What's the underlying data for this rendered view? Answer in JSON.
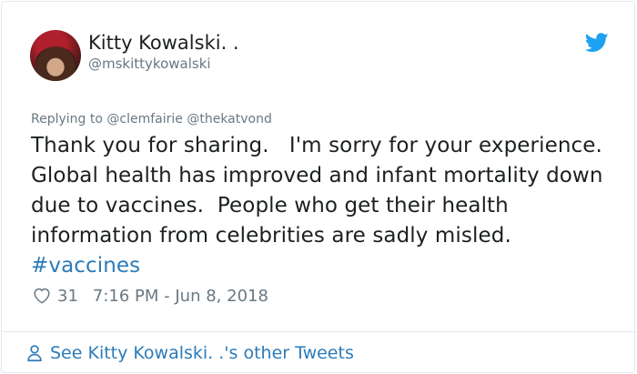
{
  "tweet": {
    "author_name": "Kitty Kowalski. .",
    "author_handle": "@mskittykowalski",
    "replying_to_prefix": "Replying to",
    "replying_to": [
      "@clemfairie",
      "@thekatvond"
    ],
    "text": "Thank you for sharing.   I'm sorry for your experience.   Global health has improved and infant mortality down due to vaccines.  People who get their health information from celebrities are sadly misled.  ",
    "hashtag": "#vaccines",
    "likes": "31",
    "timestamp": "7:16 PM - Jun 8, 2018"
  },
  "footer": {
    "other_tweets_label": "See Kitty Kowalski. .'s other Tweets"
  },
  "icons": {
    "brand": "twitter-bird-icon",
    "like": "heart-icon",
    "profile": "person-icon"
  },
  "colors": {
    "link": "#2b7bb9",
    "twitter_blue": "#1da1f2",
    "muted": "#697882",
    "text": "#1c2022",
    "border": "#e1e8ed"
  }
}
